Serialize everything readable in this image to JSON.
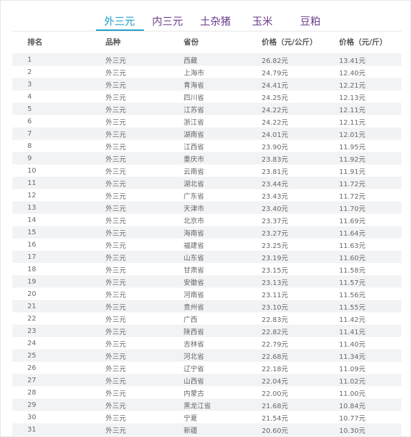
{
  "tabs": [
    "外三元",
    "内三元",
    "土杂猪",
    "玉米",
    "豆粕"
  ],
  "columns": [
    "排名",
    "品种",
    "省份",
    "价格（元/公斤）",
    "价格（元/斤）"
  ],
  "rows": [
    [
      "1",
      "外三元",
      "西藏",
      "26.82元",
      "13.41元"
    ],
    [
      "2",
      "外三元",
      "上海市",
      "24.79元",
      "12.40元"
    ],
    [
      "3",
      "外三元",
      "青海省",
      "24.41元",
      "12.21元"
    ],
    [
      "4",
      "外三元",
      "四川省",
      "24.25元",
      "12.13元"
    ],
    [
      "5",
      "外三元",
      "江苏省",
      "24.22元",
      "12.11元"
    ],
    [
      "6",
      "外三元",
      "浙江省",
      "24.22元",
      "12.11元"
    ],
    [
      "7",
      "外三元",
      "湖南省",
      "24.01元",
      "12.01元"
    ],
    [
      "8",
      "外三元",
      "江西省",
      "23.90元",
      "11.95元"
    ],
    [
      "9",
      "外三元",
      "重庆市",
      "23.83元",
      "11.92元"
    ],
    [
      "10",
      "外三元",
      "云南省",
      "23.81元",
      "11.91元"
    ],
    [
      "11",
      "外三元",
      "湖北省",
      "23.44元",
      "11.72元"
    ],
    [
      "12",
      "外三元",
      "广东省",
      "23.43元",
      "11.72元"
    ],
    [
      "13",
      "外三元",
      "天津市",
      "23.40元",
      "11.70元"
    ],
    [
      "14",
      "外三元",
      "北京市",
      "23.37元",
      "11.69元"
    ],
    [
      "15",
      "外三元",
      "海南省",
      "23.27元",
      "11.64元"
    ],
    [
      "16",
      "外三元",
      "福建省",
      "23.25元",
      "11.63元"
    ],
    [
      "17",
      "外三元",
      "山东省",
      "23.19元",
      "11.60元"
    ],
    [
      "18",
      "外三元",
      "甘肃省",
      "23.15元",
      "11.58元"
    ],
    [
      "19",
      "外三元",
      "安徽省",
      "23.13元",
      "11.57元"
    ],
    [
      "20",
      "外三元",
      "河南省",
      "23.11元",
      "11.56元"
    ],
    [
      "21",
      "外三元",
      "贵州省",
      "23.10元",
      "11.55元"
    ],
    [
      "22",
      "外三元",
      "广西",
      "22.83元",
      "11.42元"
    ],
    [
      "23",
      "外三元",
      "陕西省",
      "22.82元",
      "11.41元"
    ],
    [
      "24",
      "外三元",
      "吉林省",
      "22.79元",
      "11.40元"
    ],
    [
      "25",
      "外三元",
      "河北省",
      "22.68元",
      "11.34元"
    ],
    [
      "26",
      "外三元",
      "辽宁省",
      "22.18元",
      "11.09元"
    ],
    [
      "27",
      "外三元",
      "山西省",
      "22.04元",
      "11.02元"
    ],
    [
      "28",
      "外三元",
      "内蒙古",
      "22.00元",
      "11.00元"
    ],
    [
      "29",
      "外三元",
      "黑龙江省",
      "21.68元",
      "10.84元"
    ],
    [
      "30",
      "外三元",
      "宁夏",
      "21.54元",
      "10.77元"
    ],
    [
      "31",
      "外三元",
      "新疆",
      "20.60元",
      "10.30元"
    ]
  ]
}
